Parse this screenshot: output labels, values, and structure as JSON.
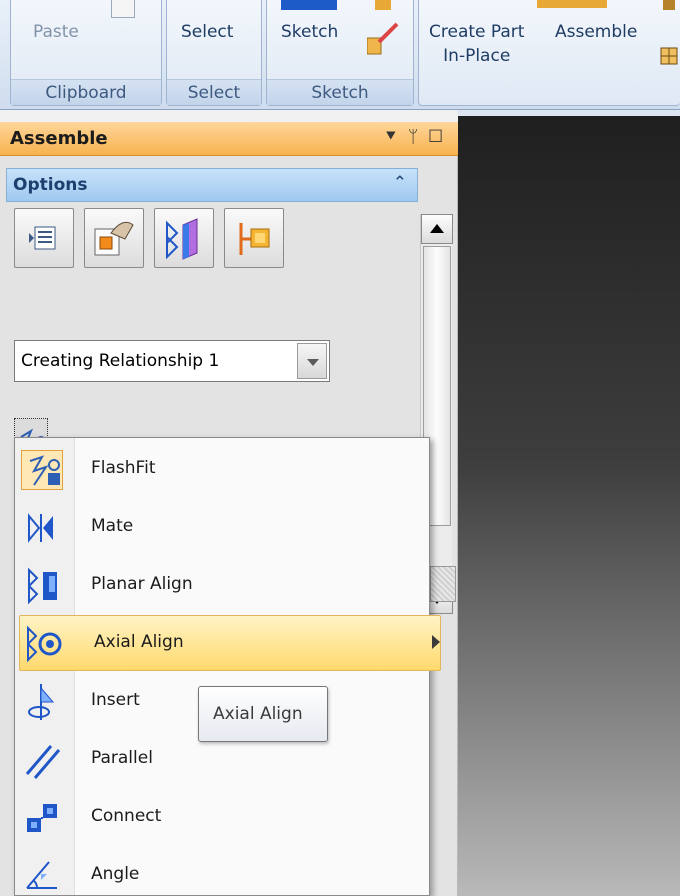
{
  "ribbon": {
    "paste_label": "Paste",
    "clipboard_label": "Clipboard",
    "select_button": "Select",
    "select_group": "Select",
    "sketch_button": "Sketch",
    "sketch_group": "Sketch",
    "create_part_line1": "Create Part",
    "create_part_line2": "In-Place",
    "assemble_button": "Assemble"
  },
  "panel": {
    "title": "Assemble",
    "ctl_dropdown": "▾",
    "ctl_pin": "📌",
    "ctl_max": "☐",
    "options_header": "Options",
    "collapse_icon": "⌃",
    "relationship_select": "Creating Relationship 1"
  },
  "menu": {
    "items": [
      {
        "label": "FlashFit",
        "icon": "flashfit-icon"
      },
      {
        "label": "Mate",
        "icon": "mate-icon"
      },
      {
        "label": "Planar Align",
        "icon": "planar-align-icon"
      },
      {
        "label": "Axial Align",
        "icon": "axial-align-icon"
      },
      {
        "label": "Insert",
        "icon": "insert-icon"
      },
      {
        "label": "Parallel",
        "icon": "parallel-icon"
      },
      {
        "label": "Connect",
        "icon": "connect-icon"
      },
      {
        "label": "Angle",
        "icon": "angle-icon"
      }
    ],
    "highlighted": "Axial Align"
  },
  "tooltip": {
    "text": "Axial Align"
  },
  "colors": {
    "panel_title_bg": "#f7b24f",
    "options_header_bg": "#9fc9ef",
    "highlight": "#ffd96c"
  }
}
